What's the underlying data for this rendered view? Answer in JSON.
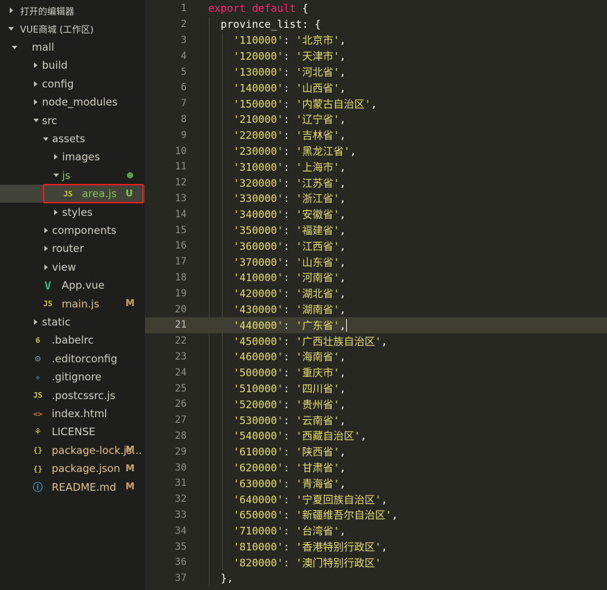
{
  "sidebar": {
    "open_editors_label": "打开的编辑器",
    "workspace_label": "VUE商城 (工作区)",
    "tree": [
      {
        "label": "mall",
        "type": "folder",
        "expanded": true,
        "indent": 0
      },
      {
        "label": "build",
        "type": "folder",
        "expanded": false,
        "indent": 1
      },
      {
        "label": "config",
        "type": "folder",
        "expanded": false,
        "indent": 1
      },
      {
        "label": "node_modules",
        "type": "folder",
        "expanded": false,
        "indent": 1
      },
      {
        "label": "src",
        "type": "folder",
        "expanded": true,
        "indent": 1
      },
      {
        "label": "assets",
        "type": "folder",
        "expanded": true,
        "indent": 2
      },
      {
        "label": "images",
        "type": "folder",
        "expanded": false,
        "indent": 3
      },
      {
        "label": "js",
        "type": "folder",
        "expanded": true,
        "indent": 3,
        "dot": true
      },
      {
        "label": "area.js",
        "type": "js",
        "indent": 4,
        "badge": "U",
        "selected": true
      },
      {
        "label": "styles",
        "type": "folder",
        "expanded": false,
        "indent": 3
      },
      {
        "label": "components",
        "type": "folder",
        "expanded": false,
        "indent": 2
      },
      {
        "label": "router",
        "type": "folder",
        "expanded": false,
        "indent": 2
      },
      {
        "label": "view",
        "type": "folder",
        "expanded": false,
        "indent": 2
      },
      {
        "label": "App.vue",
        "type": "vue",
        "indent": 2
      },
      {
        "label": "main.js",
        "type": "js",
        "indent": 2,
        "badge": "M"
      },
      {
        "label": "static",
        "type": "folder",
        "expanded": false,
        "indent": 1
      },
      {
        "label": ".babelrc",
        "type": "babel",
        "indent": 1
      },
      {
        "label": ".editorconfig",
        "type": "gear",
        "indent": 1
      },
      {
        "label": ".gitignore",
        "type": "git",
        "indent": 1
      },
      {
        "label": ".postcssrc.js",
        "type": "js",
        "indent": 1
      },
      {
        "label": "index.html",
        "type": "html",
        "indent": 1
      },
      {
        "label": "LICENSE",
        "type": "license",
        "indent": 1
      },
      {
        "label": "package-lock.js...",
        "type": "json",
        "indent": 1,
        "badge": "M"
      },
      {
        "label": "package.json",
        "type": "json",
        "indent": 1,
        "badge": "M"
      },
      {
        "label": "README.md",
        "type": "info",
        "indent": 1,
        "badge": "M"
      }
    ],
    "icons": {
      "js": "JS",
      "vue": "V",
      "babel": "6",
      "gear": "⚙",
      "git": "◆",
      "html": "<>",
      "license": "⚘",
      "json": "{}",
      "info": "ⓘ"
    },
    "icon_colors": {
      "js": "#cbcb41",
      "vue": "#41b883",
      "babel": "#cbcb41",
      "gear": "#7f8c99",
      "git": "#41535b",
      "html": "#e37933",
      "license": "#cbcb41",
      "json": "#cbcb41",
      "info": "#519aba"
    }
  },
  "editor": {
    "current_line": 21,
    "header_line": "export default {",
    "object_key": "province_list",
    "provinces": [
      [
        "110000",
        "北京市"
      ],
      [
        "120000",
        "天津市"
      ],
      [
        "130000",
        "河北省"
      ],
      [
        "140000",
        "山西省"
      ],
      [
        "150000",
        "内蒙古自治区"
      ],
      [
        "210000",
        "辽宁省"
      ],
      [
        "220000",
        "吉林省"
      ],
      [
        "230000",
        "黑龙江省"
      ],
      [
        "310000",
        "上海市"
      ],
      [
        "320000",
        "江苏省"
      ],
      [
        "330000",
        "浙江省"
      ],
      [
        "340000",
        "安徽省"
      ],
      [
        "350000",
        "福建省"
      ],
      [
        "360000",
        "江西省"
      ],
      [
        "370000",
        "山东省"
      ],
      [
        "410000",
        "河南省"
      ],
      [
        "420000",
        "湖北省"
      ],
      [
        "430000",
        "湖南省"
      ],
      [
        "440000",
        "广东省"
      ],
      [
        "450000",
        "广西壮族自治区"
      ],
      [
        "460000",
        "海南省"
      ],
      [
        "500000",
        "重庆市"
      ],
      [
        "510000",
        "四川省"
      ],
      [
        "520000",
        "贵州省"
      ],
      [
        "530000",
        "云南省"
      ],
      [
        "540000",
        "西藏自治区"
      ],
      [
        "610000",
        "陕西省"
      ],
      [
        "620000",
        "甘肃省"
      ],
      [
        "630000",
        "青海省"
      ],
      [
        "640000",
        "宁夏回族自治区"
      ],
      [
        "650000",
        "新疆维吾尔自治区"
      ],
      [
        "710000",
        "台湾省"
      ],
      [
        "810000",
        "香港特别行政区"
      ],
      [
        "820000",
        "澳门特别行政区"
      ]
    ],
    "closing_line": "},",
    "colors": {
      "keyword": "#f92672",
      "string": "#e6db74",
      "text": "#f8f8f2"
    }
  }
}
